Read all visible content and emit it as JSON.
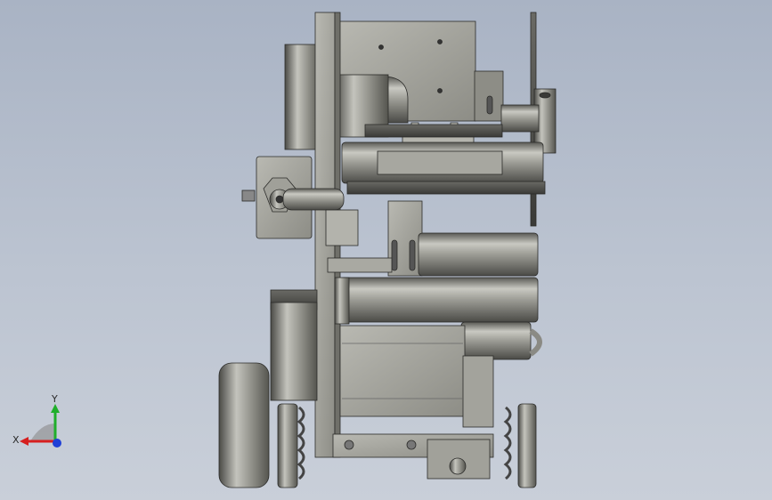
{
  "view": {
    "background_top": "#a9b3c4",
    "background_bottom": "#c9cfd9",
    "part_color": "#9a9a94",
    "part_shadow": "#4e4e4a",
    "part_highlight": "#d6d6d0"
  },
  "triad": {
    "x_label": "X",
    "y_label": "Y",
    "x_color": "#d61f1f",
    "y_color": "#1fae2a",
    "z_color": "#1f3fd6"
  }
}
